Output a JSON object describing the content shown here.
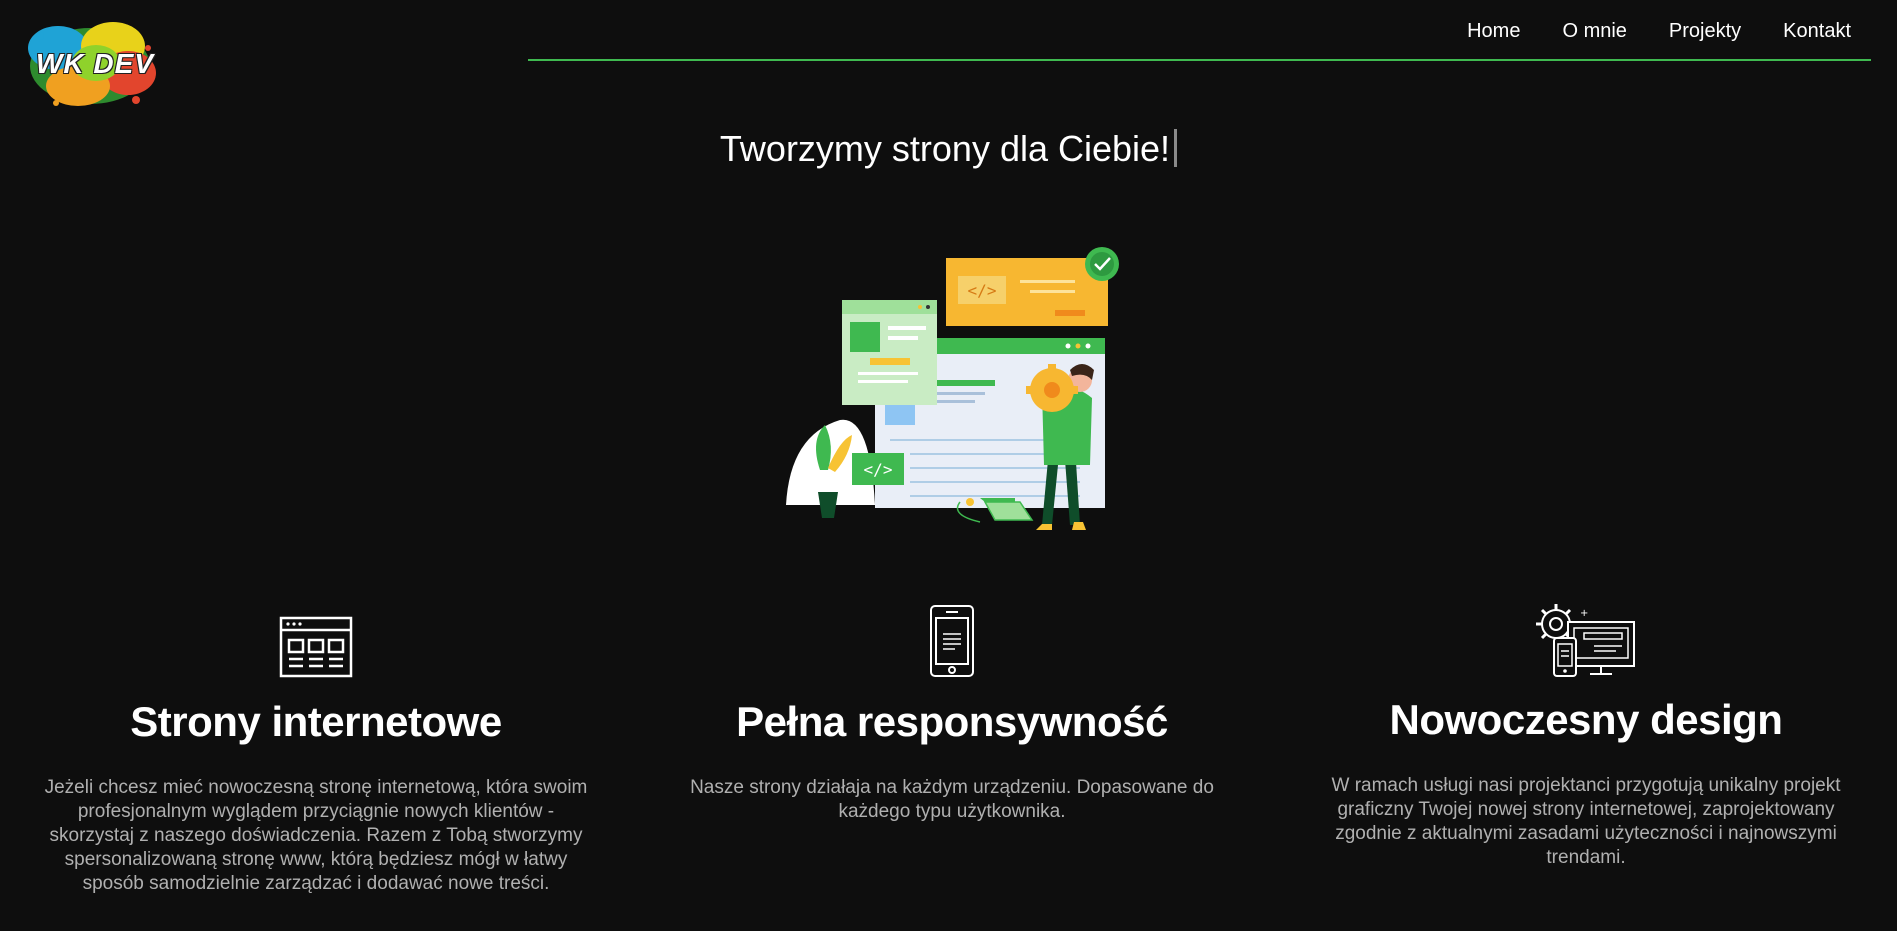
{
  "logo": {
    "text": "WK DEV"
  },
  "nav": {
    "items": [
      {
        "label": "Home"
      },
      {
        "label": "O mnie"
      },
      {
        "label": "Projekty"
      },
      {
        "label": "Kontakt"
      }
    ]
  },
  "hero": {
    "title": "Tworzymy strony dla Ciebie!"
  },
  "features": [
    {
      "icon": "browser-window-icon",
      "title": "Strony internetowe",
      "text": "Jeżeli chcesz mieć nowoczesną stronę internetową, która swoim profesjonalnym wyglądem przyciągnie nowych klientów - skorzystaj z naszego doświadczenia. Razem z Tobą stworzymy spersonalizowaną stronę www, którą będziesz mógł w łatwy sposób samodzielnie zarządzać i dodawać nowe treści."
    },
    {
      "icon": "smartphone-icon",
      "title": "Pełna responsywność",
      "text": "Nasze strony działaja na każdym urządzeniu. Dopasowane do każdego typu użytkownika."
    },
    {
      "icon": "devices-gear-icon",
      "title": "Nowoczesny design",
      "text": "W ramach usługi nasi projektanci przygotują unikalny projekt graficzny Twojej nowej strony internetowej, zaprojektowany zgodnie z aktualnymi zasadami użyteczności i najnowszymi trendami."
    }
  ],
  "colors": {
    "background": "#0e0e0e",
    "accent": "#3fb950",
    "text": "#ffffff",
    "muted_text": "#b0b0b0"
  }
}
